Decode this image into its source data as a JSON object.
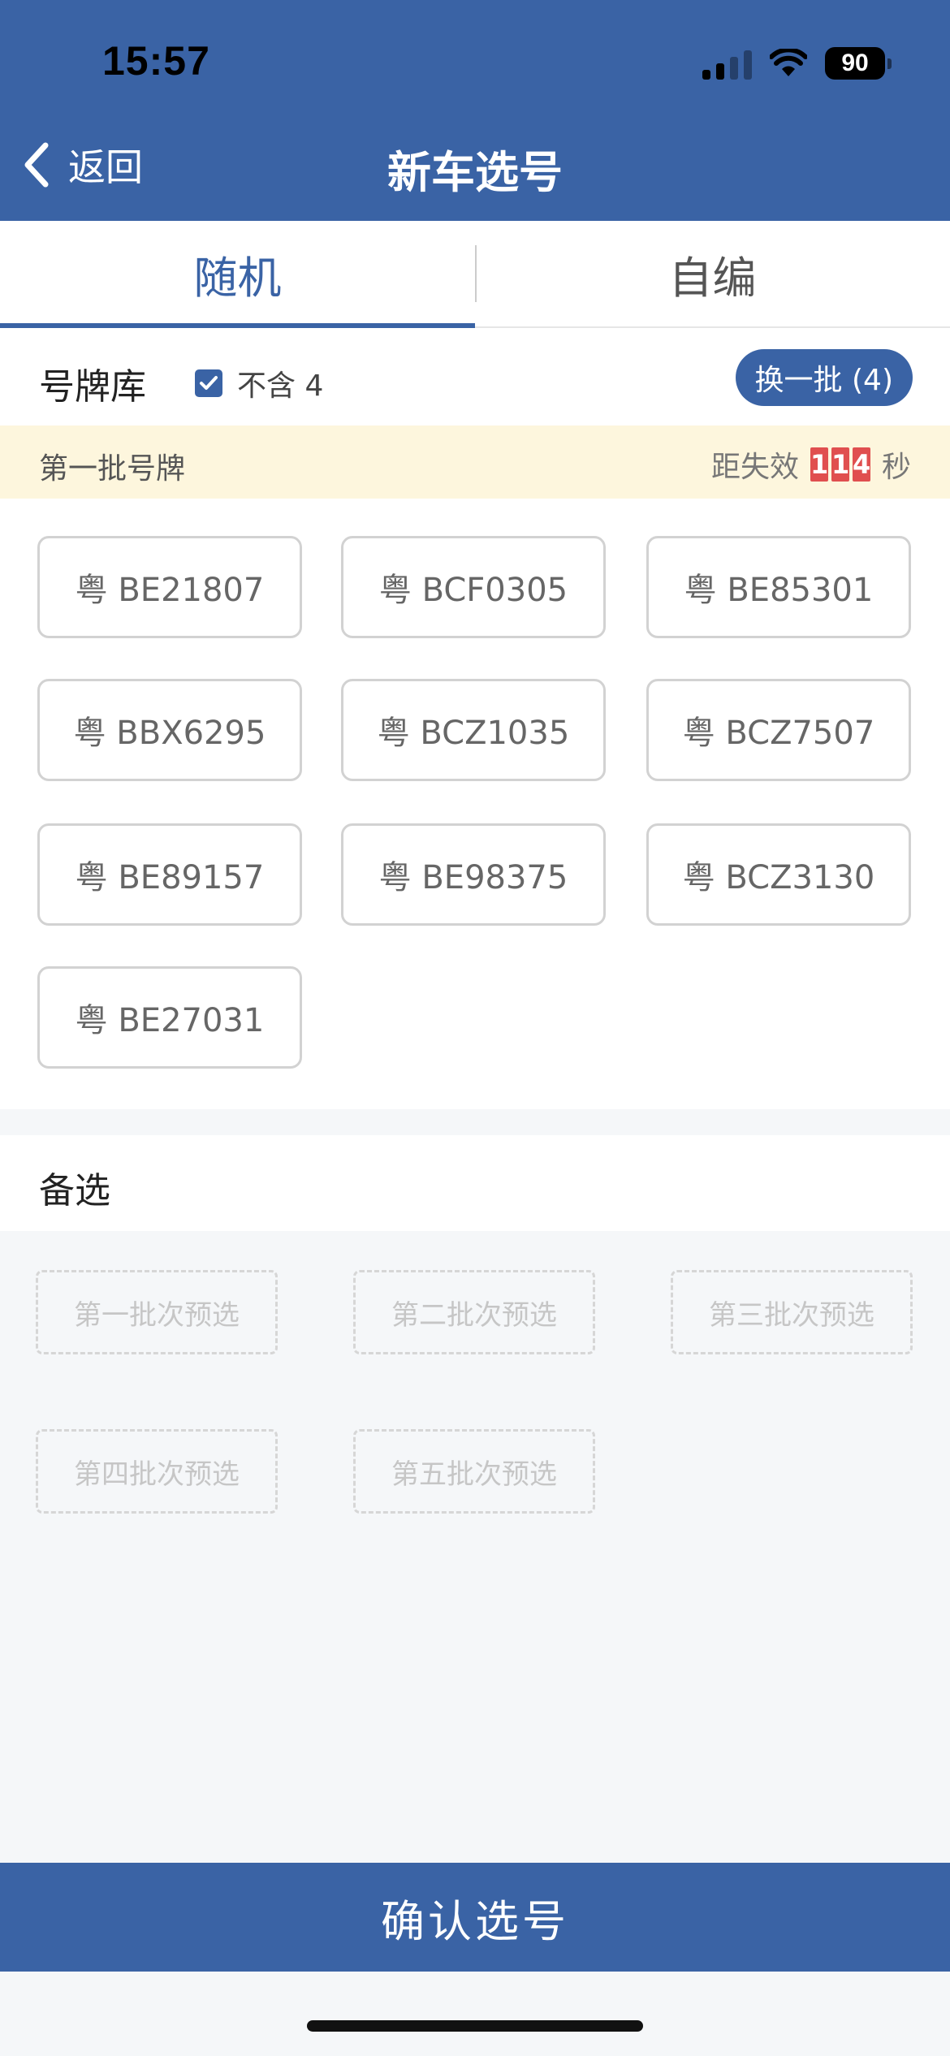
{
  "status": {
    "time": "15:57",
    "battery": "90"
  },
  "nav": {
    "back_label": "返回",
    "title": "新车选号"
  },
  "tabs": [
    {
      "label": "随机",
      "active": true
    },
    {
      "label": "自编",
      "active": false
    }
  ],
  "library": {
    "title": "号牌库",
    "exclude_four_label": "不含 4",
    "exclude_four_checked": true,
    "refresh_label": "换一批 (4)"
  },
  "batch": {
    "title": "第一批号牌",
    "countdown_prefix": "距失效",
    "countdown_digits": [
      "1",
      "1",
      "4"
    ],
    "countdown_suffix": "秒"
  },
  "plates": [
    "粤 BE21807",
    "粤 BCF0305",
    "粤 BE85301",
    "粤 BBX6295",
    "粤 BCZ1035",
    "粤 BCZ7507",
    "粤 BE89157",
    "粤 BE98375",
    "粤 BCZ3130",
    "粤 BE27031"
  ],
  "alternates": {
    "title": "备选",
    "slots": [
      "第一批次预选",
      "第二批次预选",
      "第三批次预选",
      "第四批次预选",
      "第五批次预选"
    ]
  },
  "confirm_label": "确认选号",
  "colors": {
    "primary": "#3a63a5",
    "countdown": "#e04f4f",
    "batch_bg": "#fdf6dd"
  }
}
